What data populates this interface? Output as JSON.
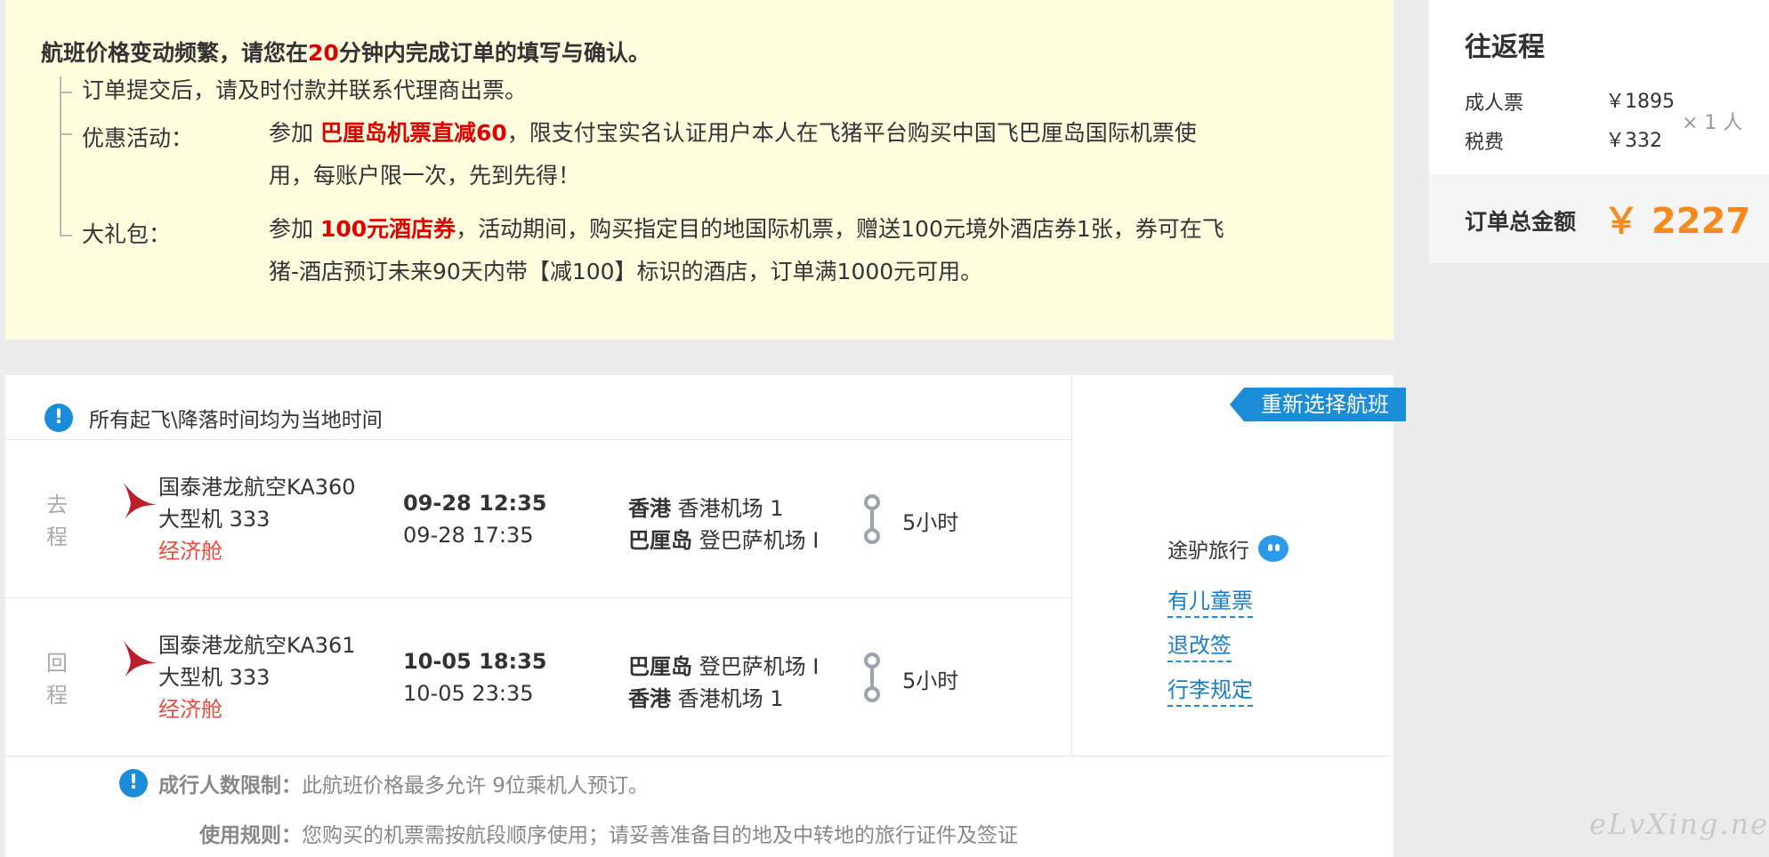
{
  "notice": {
    "title_prefix": "航班价格变动频繁，请您在",
    "title_minutes": "20",
    "title_suffix": "分钟内完成订单的填写与确认。",
    "items": [
      {
        "text": "订单提交后，请及时付款并联系代理商出票。"
      },
      {
        "label": "优惠活动：",
        "prefix": "参加 ",
        "highlight": "巴厘岛机票直减60",
        "line1_suffix": "，限支付宝实名认证用户本人在飞猪平台购买中国飞巴厘岛国际机票使",
        "line2": "用，每账户限一次，先到先得！"
      },
      {
        "label": "大礼包：",
        "prefix": "参加 ",
        "highlight": "100元酒店券",
        "line1_suffix": "，活动期间，购买指定目的地国际机票，赠送100元境外酒店券1张，券可在飞",
        "line2": "猪-酒店预订未来90天内带【减100】标识的酒店，订单满1000元可用。"
      }
    ]
  },
  "price": {
    "trip_type": "往返程",
    "adult_label": "成人票",
    "adult_value": "￥1895",
    "tax_label": "税费",
    "tax_value": "￥332",
    "multiplier": "× 1 人",
    "total_label": "订单总金额",
    "total_value": "￥ 2227",
    "accent_color": "#f58a1f"
  },
  "flight": {
    "time_note": "所有起飞\\降落时间均为当地时间",
    "legs": [
      {
        "direction_1": "去",
        "direction_2": "程",
        "airline": "国泰港龙航空KA360",
        "aircraft": "大型机 333",
        "cabin": "经济舱",
        "dep_time": "09-28 12:35",
        "arr_time": "09-28 17:35",
        "dep_city": "香港",
        "dep_airport": "香港机场 1",
        "arr_city": "巴厘岛",
        "arr_airport": "登巴萨机场 I",
        "duration": "5小时"
      },
      {
        "direction_1": "回",
        "direction_2": "程",
        "airline": "国泰港龙航空KA361",
        "aircraft": "大型机 333",
        "cabin": "经济舱",
        "dep_time": "10-05 18:35",
        "arr_time": "10-05 23:35",
        "dep_city": "巴厘岛",
        "dep_airport": "登巴萨机场 I",
        "arr_city": "香港",
        "arr_airport": "香港机场 1",
        "duration": "5小时"
      }
    ],
    "reselect_label": "重新选择航班",
    "agent_name": "途驴旅行",
    "links": [
      "有儿童票",
      "退改签",
      "行李规定"
    ]
  },
  "footer": {
    "limit_label": "成行人数限制：",
    "limit_text": "此航班价格最多允许 9位乘机人预订。",
    "rules_label": "使用规则：",
    "rules_text": "您购买的机票需按航段顺序使用；请妥善准备目的地及中转地的旅行证件及签证"
  },
  "watermark": "eLvXing.net"
}
